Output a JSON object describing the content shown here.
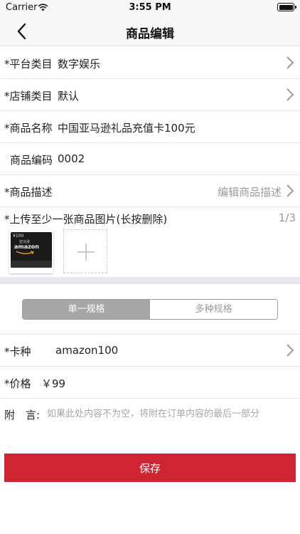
{
  "status_bar": {
    "carrier": "Carrier",
    "time": "3:55 PM"
  },
  "nav": {
    "title": "商品编辑"
  },
  "rows": {
    "platform_category": {
      "label": "*平台类目",
      "value": "数字娱乐"
    },
    "store_category": {
      "label": "*店铺类目",
      "value": "默认"
    },
    "product_name": {
      "label": "*商品名称",
      "value": "中国亚马逊礼品充值卡100元"
    },
    "product_code": {
      "label": "商品编码",
      "value": "0002"
    },
    "product_desc": {
      "label": "*商品描述",
      "hint": "编辑商品描述"
    }
  },
  "upload": {
    "label": "*上传至少一张商品图片(长按删除)",
    "count": "1/3",
    "thumbnail": {
      "amount": "¥100",
      "brand": "amazon",
      "brand_cn": "亚马逊"
    }
  },
  "spec_tabs": [
    {
      "label": "单一规格",
      "active": true
    },
    {
      "label": "多种规格",
      "active": false
    }
  ],
  "spec": {
    "card_type": {
      "label": "*卡种",
      "value": "amazon100"
    },
    "price": {
      "label": "*价格",
      "value": "￥99"
    },
    "remark": {
      "label": "附　言:",
      "placeholder": "如果此处内容不为空，将附在订单内容的最后一部分",
      "value": ""
    }
  },
  "save_button": {
    "label": "保存"
  },
  "colors": {
    "accent": "#cf2432",
    "segment_active": "#a7a7a7",
    "divider": "#e9e8ed"
  }
}
